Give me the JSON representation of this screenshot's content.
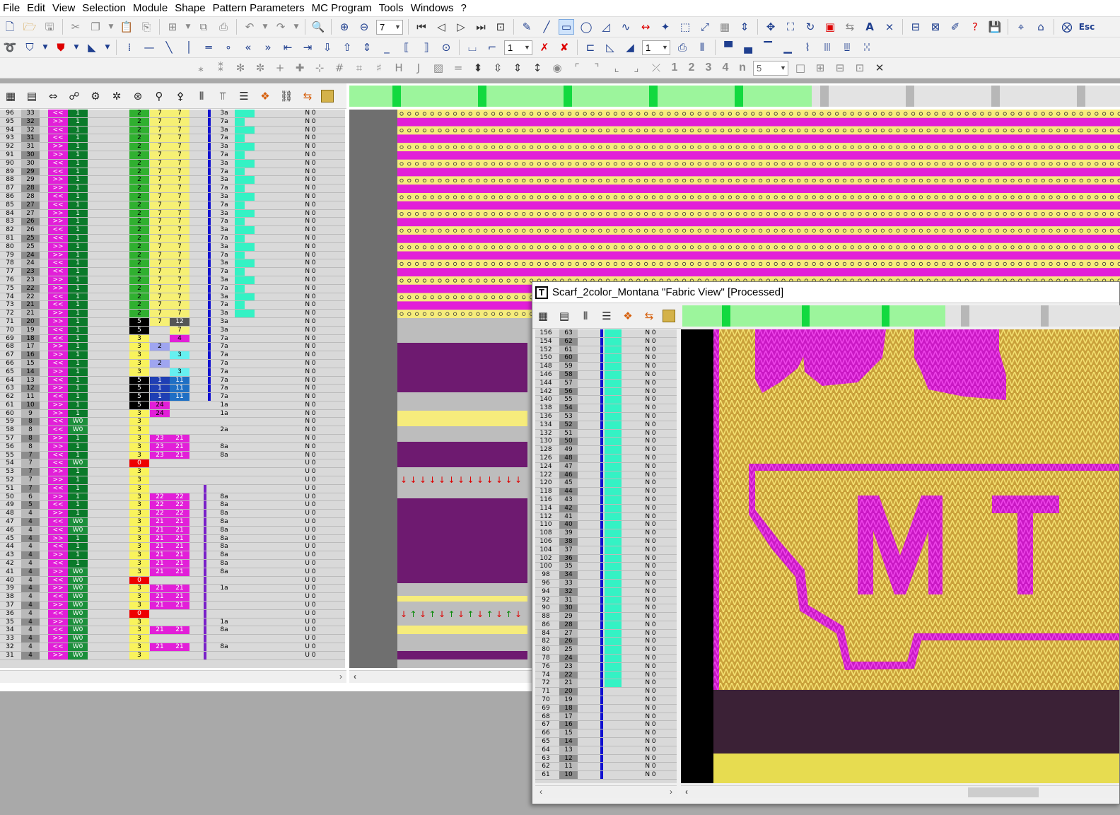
{
  "menu": [
    "File",
    "Edit",
    "View",
    "Selection",
    "Module",
    "Shape",
    "Pattern Parameters",
    "MC Program",
    "Tools",
    "Windows",
    "?"
  ],
  "toolbar1": {
    "zoom_value": "7",
    "icons": [
      "new-file-icon",
      "open-folder-icon",
      "save-icon",
      "cut-icon",
      "copy-icon",
      "paste-icon",
      "paste-special-icon",
      "paste-sequence-icon",
      "paste-pattern-icon",
      "insert-icon",
      "undo-icon",
      "redo-icon",
      "help-context-icon",
      "zoom-in-icon",
      "zoom-out-icon"
    ],
    "esc_label": "Esc"
  },
  "toolbar2": {
    "line_value": "1",
    "line_value_2": "1"
  },
  "toolbar3": {
    "number_buttons": [
      "1",
      "2",
      "3",
      "4",
      "n"
    ],
    "count_value": "5"
  },
  "colors": {
    "magenta": "#e21fd8",
    "yellow": "#f6ec7c",
    "purple_dark": "#6e1a70",
    "green_light": "#9cf59c",
    "green_dark": "#0a7a2a",
    "cyan": "#34f2c4",
    "blue_bar": "#1010d0"
  },
  "main_table": {
    "rows": [
      {
        "n": "96",
        "c2": "33",
        "dir": "<<",
        "sys": "1",
        "a": "2",
        "b": "7",
        "c": "7",
        "e": "3a",
        "f": "N 0"
      },
      {
        "n": "95",
        "c2": "32",
        "dir": ">>",
        "sys": "1",
        "a": "2",
        "b": "7",
        "c": "7",
        "e": "7a",
        "f": "N 0"
      },
      {
        "n": "94",
        "c2": "32",
        "dir": "<<",
        "sys": "1",
        "a": "2",
        "b": "7",
        "c": "7",
        "e": "3a",
        "f": "N 0"
      },
      {
        "n": "93",
        "c2": "31",
        "dir": "<<",
        "sys": "1",
        "a": "2",
        "b": "7",
        "c": "7",
        "e": "7a",
        "f": "N 0"
      },
      {
        "n": "92",
        "c2": "31",
        "dir": ">>",
        "sys": "1",
        "a": "2",
        "b": "7",
        "c": "7",
        "e": "3a",
        "f": "N 0"
      },
      {
        "n": "91",
        "c2": "30",
        "dir": ">>",
        "sys": "1",
        "a": "2",
        "b": "7",
        "c": "7",
        "e": "7a",
        "f": "N 0"
      },
      {
        "n": "90",
        "c2": "30",
        "dir": "<<",
        "sys": "1",
        "a": "2",
        "b": "7",
        "c": "7",
        "e": "3a",
        "f": "N 0"
      },
      {
        "n": "89",
        "c2": "29",
        "dir": "<<",
        "sys": "1",
        "a": "2",
        "b": "7",
        "c": "7",
        "e": "7a",
        "f": "N 0"
      },
      {
        "n": "88",
        "c2": "29",
        "dir": ">>",
        "sys": "1",
        "a": "2",
        "b": "7",
        "c": "7",
        "e": "3a",
        "f": "N 0"
      },
      {
        "n": "87",
        "c2": "28",
        "dir": ">>",
        "sys": "1",
        "a": "2",
        "b": "7",
        "c": "7",
        "e": "7a",
        "f": "N 0"
      },
      {
        "n": "86",
        "c2": "28",
        "dir": "<<",
        "sys": "1",
        "a": "2",
        "b": "7",
        "c": "7",
        "e": "3a",
        "f": "N 0"
      },
      {
        "n": "85",
        "c2": "27",
        "dir": "<<",
        "sys": "1",
        "a": "2",
        "b": "7",
        "c": "7",
        "e": "7a",
        "f": "N 0"
      },
      {
        "n": "84",
        "c2": "27",
        "dir": ">>",
        "sys": "1",
        "a": "2",
        "b": "7",
        "c": "7",
        "e": "3a",
        "f": "N 0"
      },
      {
        "n": "83",
        "c2": "26",
        "dir": ">>",
        "sys": "1",
        "a": "2",
        "b": "7",
        "c": "7",
        "e": "7a",
        "f": "N 0"
      },
      {
        "n": "82",
        "c2": "26",
        "dir": "<<",
        "sys": "1",
        "a": "2",
        "b": "7",
        "c": "7",
        "e": "3a",
        "f": "N 0"
      },
      {
        "n": "81",
        "c2": "25",
        "dir": "<<",
        "sys": "1",
        "a": "2",
        "b": "7",
        "c": "7",
        "e": "7a",
        "f": "N 0"
      },
      {
        "n": "80",
        "c2": "25",
        "dir": ">>",
        "sys": "1",
        "a": "2",
        "b": "7",
        "c": "7",
        "e": "3a",
        "f": "N 0"
      },
      {
        "n": "79",
        "c2": "24",
        "dir": ">>",
        "sys": "1",
        "a": "2",
        "b": "7",
        "c": "7",
        "e": "7a",
        "f": "N 0"
      },
      {
        "n": "78",
        "c2": "24",
        "dir": "<<",
        "sys": "1",
        "a": "2",
        "b": "7",
        "c": "7",
        "e": "3a",
        "f": "N 0"
      },
      {
        "n": "77",
        "c2": "23",
        "dir": "<<",
        "sys": "1",
        "a": "2",
        "b": "7",
        "c": "7",
        "e": "7a",
        "f": "N 0"
      },
      {
        "n": "76",
        "c2": "23",
        "dir": ">>",
        "sys": "1",
        "a": "2",
        "b": "7",
        "c": "7",
        "e": "3a",
        "f": "N 0"
      },
      {
        "n": "75",
        "c2": "22",
        "dir": ">>",
        "sys": "1",
        "a": "2",
        "b": "7",
        "c": "7",
        "e": "7a",
        "f": "N 0"
      },
      {
        "n": "74",
        "c2": "22",
        "dir": "<<",
        "sys": "1",
        "a": "2",
        "b": "7",
        "c": "7",
        "e": "3a",
        "f": "N 0"
      },
      {
        "n": "73",
        "c2": "21",
        "dir": "<<",
        "sys": "1",
        "a": "2",
        "b": "7",
        "c": "7",
        "e": "7a",
        "f": "N 0"
      },
      {
        "n": "72",
        "c2": "21",
        "dir": ">>",
        "sys": "1",
        "a": "2",
        "b": "7",
        "c": "7",
        "e": "3a",
        "f": "N 0"
      },
      {
        "n": "71",
        "c2": "20",
        "dir": ">>",
        "sys": "1",
        "a": "5",
        "b": "7",
        "c": "12",
        "e": "3a",
        "f": "N 0"
      },
      {
        "n": "70",
        "c2": "19",
        "dir": "<<",
        "sys": "1",
        "a": "5",
        "b": "",
        "c": "7",
        "e": "3a",
        "f": "N 0"
      },
      {
        "n": "69",
        "c2": "18",
        "dir": "<<",
        "sys": "1",
        "a": "3",
        "b": "",
        "c": "4",
        "e": "7a",
        "f": "N 0"
      },
      {
        "n": "68",
        "c2": "17",
        "dir": ">>",
        "sys": "1",
        "a": "3",
        "b": "2",
        "c": "",
        "e": "7a",
        "f": "N 0"
      },
      {
        "n": "67",
        "c2": "16",
        "dir": ">>",
        "sys": "1",
        "a": "3",
        "b": "",
        "c": "3",
        "e": "7a",
        "f": "N 0"
      },
      {
        "n": "66",
        "c2": "15",
        "dir": "<<",
        "sys": "1",
        "a": "3",
        "b": "2",
        "c": "",
        "e": "7a",
        "f": "N 0"
      },
      {
        "n": "65",
        "c2": "14",
        "dir": ">>",
        "sys": "1",
        "a": "3",
        "b": "",
        "c": "3",
        "e": "7a",
        "f": "N 0"
      },
      {
        "n": "64",
        "c2": "13",
        "dir": "<<",
        "sys": "1",
        "a": "5",
        "b": "1",
        "c": "11",
        "e": "7a",
        "f": "N 0"
      },
      {
        "n": "63",
        "c2": "12",
        "dir": ">>",
        "sys": "1",
        "a": "5",
        "b": "1",
        "c": "11",
        "e": "7a",
        "f": "N 0"
      },
      {
        "n": "62",
        "c2": "11",
        "dir": "<<",
        "sys": "1",
        "a": "5",
        "b": "1",
        "c": "11",
        "e": "7a",
        "f": "N 0"
      },
      {
        "n": "61",
        "c2": "10",
        "dir": ">>",
        "sys": "1",
        "a": "5",
        "b": "24",
        "c": "",
        "e": "1a",
        "f": "N 0"
      },
      {
        "n": "60",
        "c2": "9",
        "dir": ">>",
        "sys": "1",
        "a": "3",
        "b": "24",
        "c": "",
        "e": "1a",
        "f": "N 0"
      },
      {
        "n": "59",
        "c2": "8",
        "dir": "<<",
        "sys": "W0",
        "a": "3",
        "b": "",
        "c": "",
        "e": "",
        "f": "N 0"
      },
      {
        "n": "58",
        "c2": "8",
        "dir": "<<",
        "sys": "W0",
        "a": "3",
        "b": "",
        "c": "",
        "e": "2a",
        "f": "N 0"
      },
      {
        "n": "57",
        "c2": "8",
        "dir": ">>",
        "sys": "1",
        "a": "3",
        "b": "23",
        "c": "21",
        "e": "",
        "f": "N 0"
      },
      {
        "n": "56",
        "c2": "8",
        "dir": ">>",
        "sys": "1",
        "a": "3",
        "b": "23",
        "c": "21",
        "e": "8a",
        "f": "N 0"
      },
      {
        "n": "55",
        "c2": "7",
        "dir": "<<",
        "sys": "1",
        "a": "3",
        "b": "23",
        "c": "21",
        "e": "8a",
        "f": "N 0"
      },
      {
        "n": "54",
        "c2": "7",
        "dir": "<<",
        "sys": "W0",
        "a": "0",
        "b": "",
        "c": "",
        "e": "",
        "f": "U 0"
      },
      {
        "n": "53",
        "c2": "7",
        "dir": ">>",
        "sys": "1",
        "a": "3",
        "b": "",
        "c": "",
        "e": "",
        "f": "U 0"
      },
      {
        "n": "52",
        "c2": "7",
        "dir": ">>",
        "sys": "1",
        "a": "3",
        "b": "",
        "c": "",
        "e": "",
        "f": "U 0"
      },
      {
        "n": "51",
        "c2": "7",
        "dir": "<<",
        "sys": "1",
        "a": "3",
        "b": "",
        "c": "",
        "e": "",
        "f": "U 0"
      },
      {
        "n": "50",
        "c2": "6",
        "dir": ">>",
        "sys": "1",
        "a": "3",
        "b": "22",
        "c": "22",
        "e": "8a",
        "f": "U 0"
      },
      {
        "n": "49",
        "c2": "5",
        "dir": "<<",
        "sys": "1",
        "a": "3",
        "b": "22",
        "c": "22",
        "e": "8a",
        "f": "U 0"
      },
      {
        "n": "48",
        "c2": "4",
        "dir": ">>",
        "sys": "1",
        "a": "3",
        "b": "22",
        "c": "22",
        "e": "8a",
        "f": "U 0"
      },
      {
        "n": "47",
        "c2": "4",
        "dir": "<<",
        "sys": "W0",
        "a": "3",
        "b": "21",
        "c": "21",
        "e": "8a",
        "f": "U 0"
      },
      {
        "n": "46",
        "c2": "4",
        "dir": "<<",
        "sys": "W0",
        "a": "3",
        "b": "21",
        "c": "21",
        "e": "8a",
        "f": "U 0"
      },
      {
        "n": "45",
        "c2": "4",
        "dir": ">>",
        "sys": "1",
        "a": "3",
        "b": "21",
        "c": "21",
        "e": "8a",
        "f": "U 0"
      },
      {
        "n": "44",
        "c2": "4",
        "dir": "<<",
        "sys": "1",
        "a": "3",
        "b": "21",
        "c": "21",
        "e": "8a",
        "f": "U 0"
      },
      {
        "n": "43",
        "c2": "4",
        "dir": ">>",
        "sys": "1",
        "a": "3",
        "b": "21",
        "c": "21",
        "e": "8a",
        "f": "U 0"
      },
      {
        "n": "42",
        "c2": "4",
        "dir": "<<",
        "sys": "1",
        "a": "3",
        "b": "21",
        "c": "21",
        "e": "8a",
        "f": "U 0"
      },
      {
        "n": "41",
        "c2": "4",
        "dir": ">>",
        "sys": "W0",
        "a": "3",
        "b": "21",
        "c": "21",
        "e": "8a",
        "f": "U 0"
      },
      {
        "n": "40",
        "c2": "4",
        "dir": "<<",
        "sys": "W0",
        "a": "0",
        "b": "",
        "c": "",
        "e": "",
        "f": "U 0"
      },
      {
        "n": "39",
        "c2": "4",
        "dir": ">>",
        "sys": "W0",
        "a": "3",
        "b": "21",
        "c": "21",
        "e": "1a",
        "f": "U 0"
      },
      {
        "n": "38",
        "c2": "4",
        "dir": "<<",
        "sys": "W0",
        "a": "3",
        "b": "21",
        "c": "21",
        "e": "",
        "f": "U 0"
      },
      {
        "n": "37",
        "c2": "4",
        "dir": ">>",
        "sys": "W0",
        "a": "3",
        "b": "21",
        "c": "21",
        "e": "",
        "f": "U 0"
      },
      {
        "n": "36",
        "c2": "4",
        "dir": "<<",
        "sys": "W0",
        "a": "0",
        "b": "",
        "c": "",
        "e": "",
        "f": "U 0"
      },
      {
        "n": "35",
        "c2": "4",
        "dir": ">>",
        "sys": "W0",
        "a": "3",
        "b": "",
        "c": "",
        "e": "1a",
        "f": "U 0"
      },
      {
        "n": "34",
        "c2": "4",
        "dir": "<<",
        "sys": "W0",
        "a": "3",
        "b": "21",
        "c": "21",
        "e": "8a",
        "f": "U 0"
      },
      {
        "n": "33",
        "c2": "4",
        "dir": ">>",
        "sys": "W0",
        "a": "3",
        "b": "",
        "c": "",
        "e": "",
        "f": "U 0"
      },
      {
        "n": "32",
        "c2": "4",
        "dir": "<<",
        "sys": "W0",
        "a": "3",
        "b": "21",
        "c": "21",
        "e": "8a",
        "f": "U 0"
      },
      {
        "n": "31",
        "c2": "4",
        "dir": ">>",
        "sys": "W0",
        "a": "3",
        "b": "",
        "c": "",
        "e": "",
        "f": "U 0"
      }
    ]
  },
  "fabric_window": {
    "title": "Scarf_2color_Montana \"Fabric View\" [Processed]",
    "rows": [
      {
        "n": "156",
        "c2": "63",
        "f": "N 0"
      },
      {
        "n": "154",
        "c2": "62",
        "f": "N 0"
      },
      {
        "n": "152",
        "c2": "61",
        "f": "N 0"
      },
      {
        "n": "150",
        "c2": "60",
        "f": "N 0"
      },
      {
        "n": "148",
        "c2": "59",
        "f": "N 0"
      },
      {
        "n": "146",
        "c2": "58",
        "f": "N 0"
      },
      {
        "n": "144",
        "c2": "57",
        "f": "N 0"
      },
      {
        "n": "142",
        "c2": "56",
        "f": "N 0"
      },
      {
        "n": "140",
        "c2": "55",
        "f": "N 0"
      },
      {
        "n": "138",
        "c2": "54",
        "f": "N 0"
      },
      {
        "n": "136",
        "c2": "53",
        "f": "N 0"
      },
      {
        "n": "134",
        "c2": "52",
        "f": "N 0"
      },
      {
        "n": "132",
        "c2": "51",
        "f": "N 0"
      },
      {
        "n": "130",
        "c2": "50",
        "f": "N 0"
      },
      {
        "n": "128",
        "c2": "49",
        "f": "N 0"
      },
      {
        "n": "126",
        "c2": "48",
        "f": "N 0"
      },
      {
        "n": "124",
        "c2": "47",
        "f": "N 0"
      },
      {
        "n": "122",
        "c2": "46",
        "f": "N 0"
      },
      {
        "n": "120",
        "c2": "45",
        "f": "N 0"
      },
      {
        "n": "118",
        "c2": "44",
        "f": "N 0"
      },
      {
        "n": "116",
        "c2": "43",
        "f": "N 0"
      },
      {
        "n": "114",
        "c2": "42",
        "f": "N 0"
      },
      {
        "n": "112",
        "c2": "41",
        "f": "N 0"
      },
      {
        "n": "110",
        "c2": "40",
        "f": "N 0"
      },
      {
        "n": "108",
        "c2": "39",
        "f": "N 0"
      },
      {
        "n": "106",
        "c2": "38",
        "f": "N 0"
      },
      {
        "n": "104",
        "c2": "37",
        "f": "N 0"
      },
      {
        "n": "102",
        "c2": "36",
        "f": "N 0"
      },
      {
        "n": "100",
        "c2": "35",
        "f": "N 0"
      },
      {
        "n": "98",
        "c2": "34",
        "f": "N 0"
      },
      {
        "n": "96",
        "c2": "33",
        "f": "N 0"
      },
      {
        "n": "94",
        "c2": "32",
        "f": "N 0"
      },
      {
        "n": "92",
        "c2": "31",
        "f": "N 0"
      },
      {
        "n": "90",
        "c2": "30",
        "f": "N 0"
      },
      {
        "n": "88",
        "c2": "29",
        "f": "N 0"
      },
      {
        "n": "86",
        "c2": "28",
        "f": "N 0"
      },
      {
        "n": "84",
        "c2": "27",
        "f": "N 0"
      },
      {
        "n": "82",
        "c2": "26",
        "f": "N 0"
      },
      {
        "n": "80",
        "c2": "25",
        "f": "N 0"
      },
      {
        "n": "78",
        "c2": "24",
        "f": "N 0"
      },
      {
        "n": "76",
        "c2": "23",
        "f": "N 0"
      },
      {
        "n": "74",
        "c2": "22",
        "f": "N 0"
      },
      {
        "n": "72",
        "c2": "21",
        "f": "N 0"
      },
      {
        "n": "71",
        "c2": "20",
        "f": "N 0"
      },
      {
        "n": "70",
        "c2": "19",
        "f": "N 0"
      },
      {
        "n": "69",
        "c2": "18",
        "f": "N 0"
      },
      {
        "n": "68",
        "c2": "17",
        "f": "N 0"
      },
      {
        "n": "67",
        "c2": "16",
        "f": "N 0"
      },
      {
        "n": "66",
        "c2": "15",
        "f": "N 0"
      },
      {
        "n": "65",
        "c2": "14",
        "f": "N 0"
      },
      {
        "n": "64",
        "c2": "13",
        "f": "N 0"
      },
      {
        "n": "63",
        "c2": "12",
        "f": "N 0"
      },
      {
        "n": "62",
        "c2": "11",
        "f": "N 0"
      },
      {
        "n": "61",
        "c2": "10",
        "f": "N 0"
      }
    ],
    "design_letters": "MT"
  }
}
